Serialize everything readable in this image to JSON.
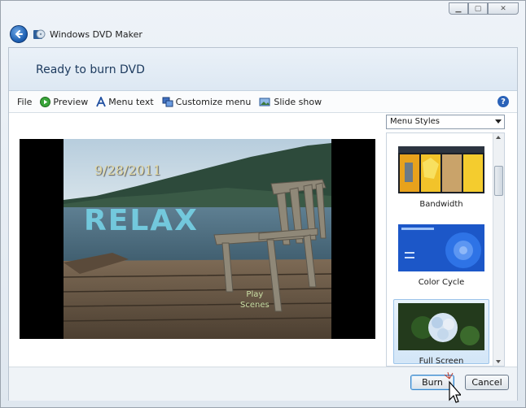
{
  "window": {
    "title": "Windows DVD Maker",
    "controls": [
      "minimize",
      "maximize",
      "close"
    ]
  },
  "header": {
    "title": "Ready to burn DVD"
  },
  "toolbar": {
    "file": "File",
    "preview": "Preview",
    "menu_text": "Menu text",
    "customize_menu": "Customize menu",
    "slide_show": "Slide show",
    "help": "?"
  },
  "preview": {
    "date": "9/28/2011",
    "title": "RELAX",
    "play_line1": "Play",
    "play_line2": "Scenes"
  },
  "menu_styles": {
    "dropdown_value": "Menu Styles",
    "items": [
      {
        "label": "Bandwidth",
        "selected": false
      },
      {
        "label": "Color Cycle",
        "selected": false
      },
      {
        "label": "Full Screen",
        "selected": true
      }
    ]
  },
  "footer": {
    "burn": "Burn",
    "cancel": "Cancel"
  },
  "colors": {
    "accent": "#2a62b8",
    "header_text": "#1c3a5e",
    "selected_bg": "#d3e6f7"
  }
}
